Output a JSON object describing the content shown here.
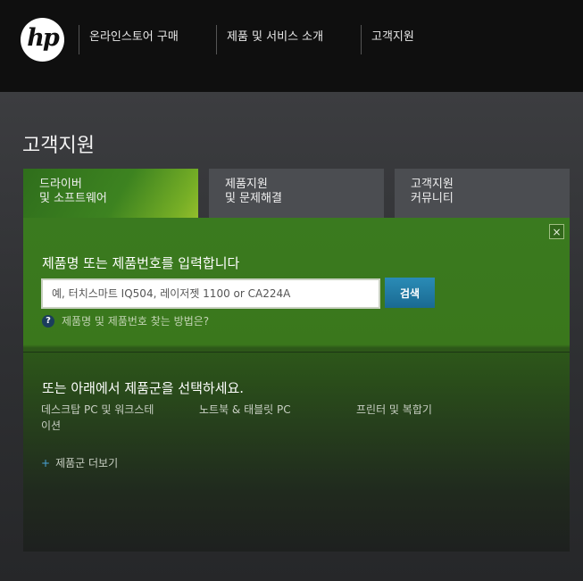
{
  "header": {
    "logo_text": "hp",
    "nav": [
      {
        "label": "온라인스토어 구매"
      },
      {
        "label": "제품 및 서비스 소개"
      },
      {
        "label": "고객지원"
      }
    ]
  },
  "page": {
    "title": "고객지원"
  },
  "tabs": [
    {
      "line1": "드라이버",
      "line2": "및 소프트웨어",
      "active": true
    },
    {
      "line1": "제품지원",
      "line2": "및 문제해결",
      "active": false
    },
    {
      "line1": "고객지원",
      "line2": "커뮤니티",
      "active": false
    }
  ],
  "panel": {
    "close_icon": "×",
    "search": {
      "heading": "제품명 또는 제품번호를 입력합니다",
      "placeholder": "예, 터치스마트 IQ504, 레이저젯 1100 or CA224A",
      "button_label": "검색"
    },
    "help": {
      "icon": "?",
      "link": "제품명 및 제품번호 찾는 방법은?"
    },
    "categories": {
      "heading": "또는 아래에서 제품군을 선택하세요.",
      "items": [
        {
          "line1": "데스크탑 PC 및 워크스테",
          "line2": "이션"
        },
        {
          "line1": "노트북 & 태블릿 PC",
          "line2": ""
        },
        {
          "line1": "프린터 및 복합기",
          "line2": ""
        }
      ],
      "more_icon": "+",
      "more_link": "제품군 더보기"
    }
  },
  "colors": {
    "topbar": "#0f0f0f",
    "accent_green": "#3d8320",
    "search_button": "#1f7aa6",
    "tab_inactive": "#4b4d51"
  }
}
